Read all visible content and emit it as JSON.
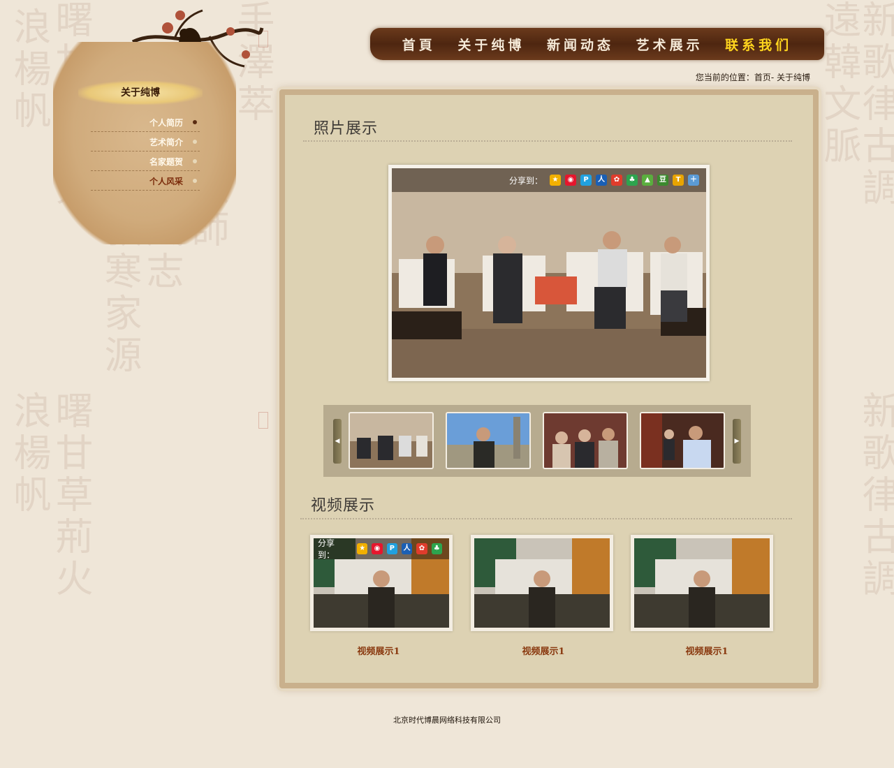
{
  "nav": {
    "items": [
      {
        "label": "首頁"
      },
      {
        "label": "关于纯博"
      },
      {
        "label": "新闻动态"
      },
      {
        "label": "艺术展示"
      },
      {
        "label": "联系我们"
      }
    ],
    "active_color": "#ffd51e"
  },
  "breadcrumb": "您当前的位置：首页- 关于纯博",
  "sidebar": {
    "title": "关于纯博",
    "items": [
      {
        "label": "个人简历"
      },
      {
        "label": "艺术简介"
      },
      {
        "label": "名家题贺"
      },
      {
        "label": "个人风采"
      }
    ]
  },
  "photo_section": {
    "title": "照片展示",
    "share_label": "分享到：",
    "share_icons": [
      "qzone-icon",
      "weibo-icon",
      "tencent-weibo-icon",
      "renren-icon",
      "kaixin-icon",
      "qq-friend-icon",
      "pengyou-icon",
      "douban-icon",
      "more-icon",
      "bookmark-icon"
    ]
  },
  "video_section": {
    "title": "视频展示",
    "share_label": "分享到：",
    "videos": [
      {
        "caption": "视频展示1"
      },
      {
        "caption": "视频展示1"
      },
      {
        "caption": "视频展示1"
      }
    ]
  },
  "footer": "北京时代博晨网络科技有限公司"
}
